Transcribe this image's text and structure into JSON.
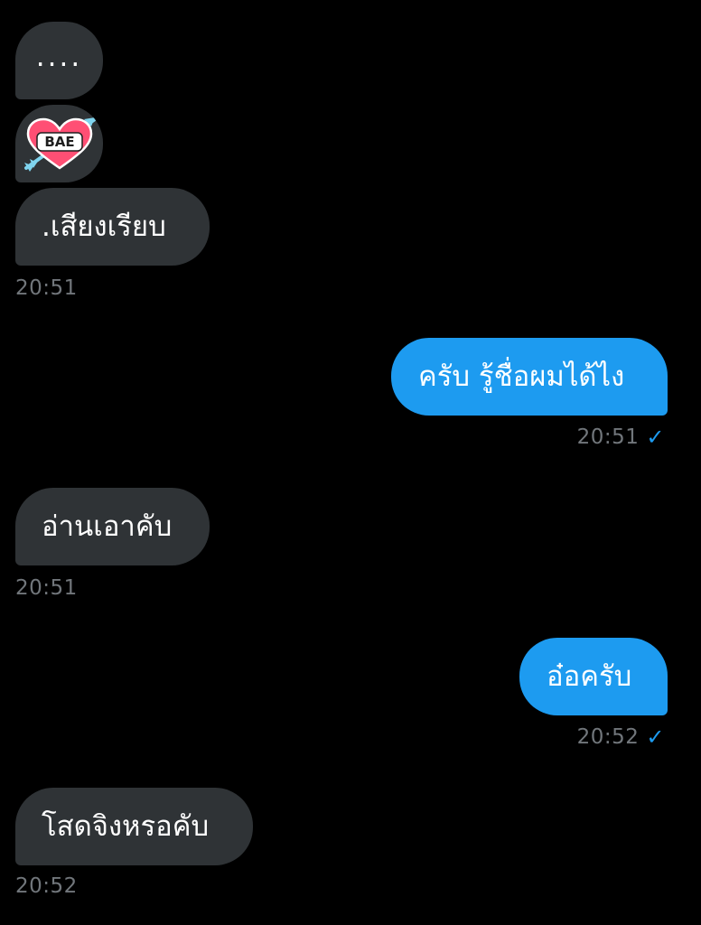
{
  "messages": [
    {
      "direction": "incoming",
      "text": "...."
    },
    {
      "direction": "incoming",
      "sticker": "heart-arrow-sticker",
      "sticker_label": "BAE"
    },
    {
      "direction": "incoming",
      "text": ".เสียงเรียบ",
      "time": "20:51"
    },
    {
      "direction": "outgoing",
      "text": "ครับ รู้ชื่อผมได้ไง",
      "time": "20:51",
      "status_icon": "check-icon"
    },
    {
      "direction": "incoming",
      "text": "อ่านเอาคับ",
      "time": "20:51"
    },
    {
      "direction": "outgoing",
      "text": "อ๋อครับ",
      "time": "20:52",
      "status_icon": "check-icon"
    },
    {
      "direction": "incoming",
      "text": "โสดจิงหรอคับ",
      "time": "20:52"
    }
  ],
  "colors": {
    "background": "#000000",
    "incoming_bubble": "#2f3336",
    "outgoing_bubble": "#1d9bf0",
    "timestamp": "#71767b",
    "heart": "#ff4f74",
    "arrow": "#7fd4ee"
  }
}
